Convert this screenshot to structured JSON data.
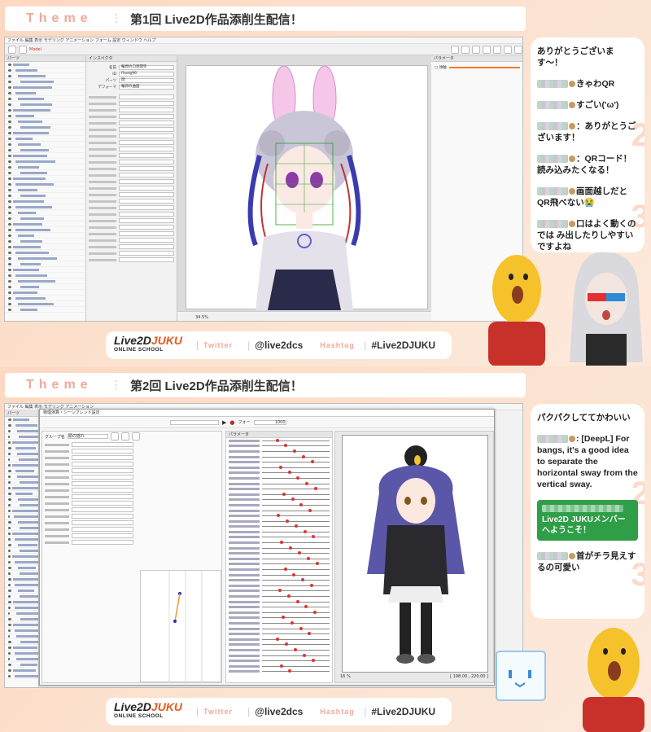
{
  "panel1": {
    "theme_label": "Theme",
    "title": "第1回 Live2D作品添削生配信！",
    "chat": [
      {
        "text": "ありがとうございます〜！"
      },
      {
        "text": "きゃわQR"
      },
      {
        "text": "すごい('ω')"
      },
      {
        "text": "：ありがとうございます！"
      },
      {
        "text": "：QRコード！読み込みたくなる！"
      },
      {
        "text": "画面越しだとQR飛べない😭"
      },
      {
        "text": "口はよく動くのでは み出したりしやすいですよね"
      }
    ],
    "app": {
      "tab_model": "Model",
      "inspector": "インスペクタ",
      "props": [
        {
          "label": "名前",
          "value": "輪郭の口寄開笑"
        },
        {
          "label": "ID",
          "value": "ffaotg96"
        },
        {
          "label": "パーツ",
          "value": "顔"
        },
        {
          "label": "デフォーマ",
          "value": "輪郭の曲面"
        }
      ],
      "zoom": "34.5%"
    }
  },
  "panel2": {
    "theme_label": "Theme",
    "title": "第2回 Live2D作品添削生配信！",
    "chat": [
      {
        "text": "パクパクしててかわいい"
      },
      {
        "text": ": [DeepL] For bangs, it's a good idea to separate the horizontal sway from the vertical sway."
      },
      {
        "text": "Live2D JUKUメンバー へようこそ！"
      },
      {
        "text": "首がチラ見えするの可愛い"
      }
    ],
    "app": {
      "dialog_title": "物理演算・シーンブレンド設定",
      "group_label": "グループ名",
      "group_value": "頭の揺れ",
      "fps_label": "フォー",
      "fps_value": "1000",
      "zoom": "16 %",
      "coords": "[ 198.00 , 220.00 ]"
    }
  },
  "footer": {
    "logo_live": "Live2D",
    "logo_juku": "JUKU",
    "logo_sub": "ONLINE SCHOOL",
    "twitter_label": "Twitter",
    "twitter_value": "@live2dcs",
    "hashtag_label": "Hashtag",
    "hashtag_value": "#Live2DJUKU"
  },
  "colors": {
    "accent": "#f0a898",
    "logo_orange": "#e85a1f",
    "chat_green": "#2e9e47"
  }
}
